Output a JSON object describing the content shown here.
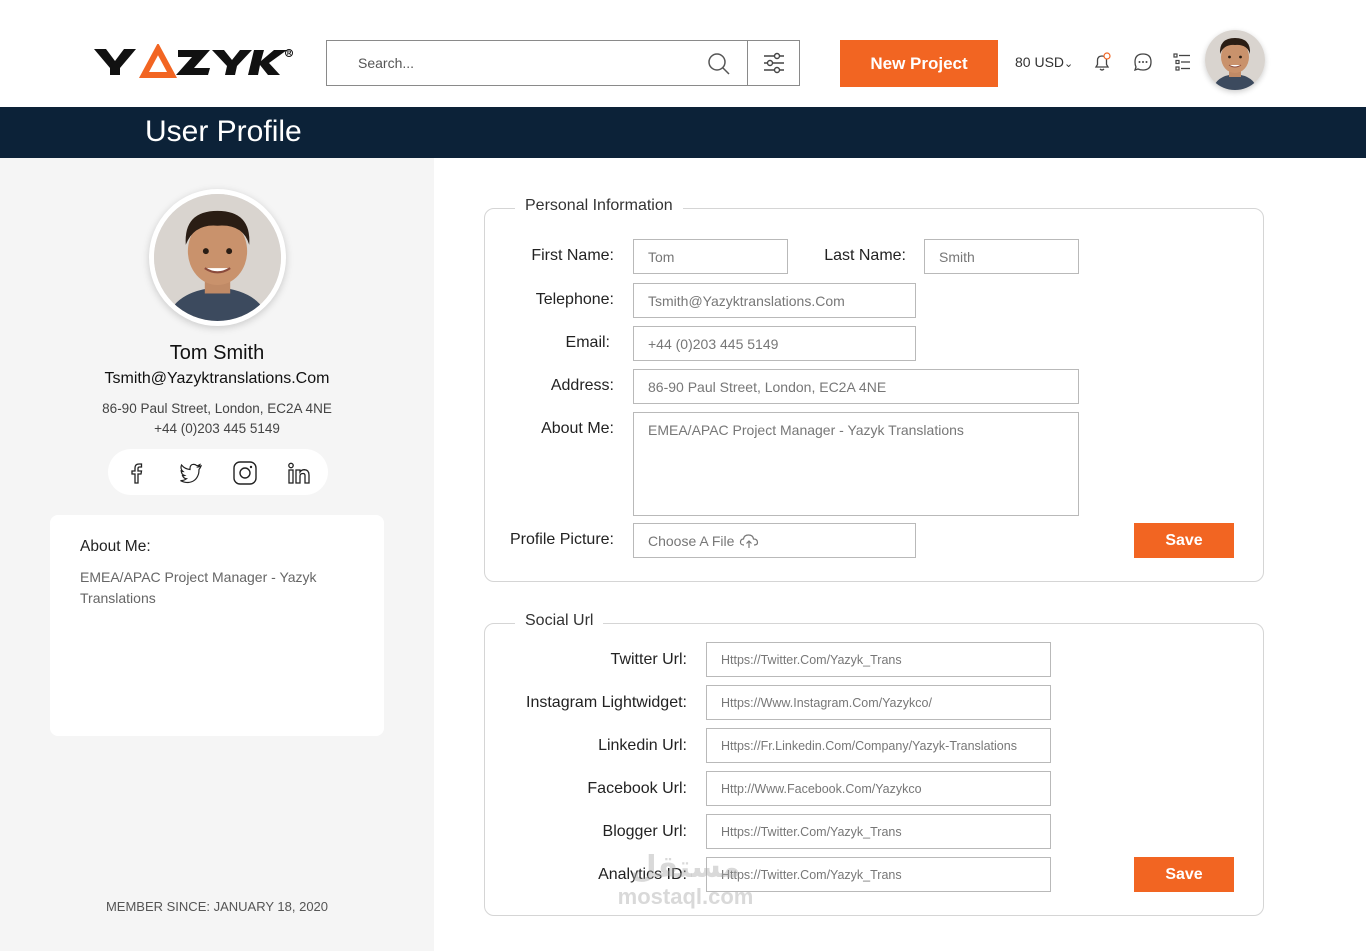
{
  "header": {
    "logo_text": "YAZYK",
    "search_placeholder": "Search...",
    "new_project_label": "New Project",
    "currency": "80 USD",
    "accent_color": "#f26522"
  },
  "title_bar": {
    "title": "User Profile",
    "background_color": "#0c2238"
  },
  "profile": {
    "name": "Tom Smith",
    "email": "Tsmith@Yazyktranslations.Com",
    "address": "86-90 Paul Street, London, EC2A 4NE",
    "phone": "+44 (0)203 445 5149",
    "social_icons": [
      "facebook-icon",
      "twitter-icon",
      "instagram-icon",
      "linkedin-icon"
    ],
    "about_title": "About Me:",
    "about_text": "EMEA/APAC Project Manager - Yazyk Translations",
    "member_since": "MEMBER SINCE: JANUARY 18, 2020"
  },
  "personal_info": {
    "legend": "Personal Information",
    "first_name_label": "First Name:",
    "first_name_value": "Tom",
    "last_name_label": "Last Name:",
    "last_name_value": "Smith",
    "telephone_label": "Telephone:",
    "telephone_value": "Tsmith@Yazyktranslations.Com",
    "email_label": "Email:",
    "email_value": "+44 (0)203 445 5149",
    "address_label": "Address:",
    "address_value": "86-90 Paul Street, London, EC2A 4NE",
    "about_label": "About Me:",
    "about_value": "EMEA/APAC Project Manager - Yazyk Translations",
    "picture_label": "Profile Picture:",
    "picture_placeholder": "Choose A File",
    "save_label": "Save"
  },
  "social_url": {
    "legend": "Social Url",
    "twitter_label": "Twitter Url:",
    "twitter_value": "Https://Twitter.Com/Yazyk_Trans",
    "instagram_label": "Instagram Lightwidget:",
    "instagram_value": "Https://Www.Instagram.Com/Yazykco/",
    "linkedin_label": "Linkedin Url:",
    "linkedin_value": "Https://Fr.Linkedin.Com/Company/Yazyk-Translations",
    "facebook_label": "Facebook Url:",
    "facebook_value": "Http://Www.Facebook.Com/Yazykco",
    "blogger_label": "Blogger Url:",
    "blogger_value": "Https://Twitter.Com/Yazyk_Trans",
    "analytics_label": "Analytics ID:",
    "analytics_value": "Https://Twitter.Com/Yazyk_Trans",
    "save_label": "Save"
  },
  "watermark": {
    "arabic": "مستقل",
    "latin": "mostaql.com"
  }
}
